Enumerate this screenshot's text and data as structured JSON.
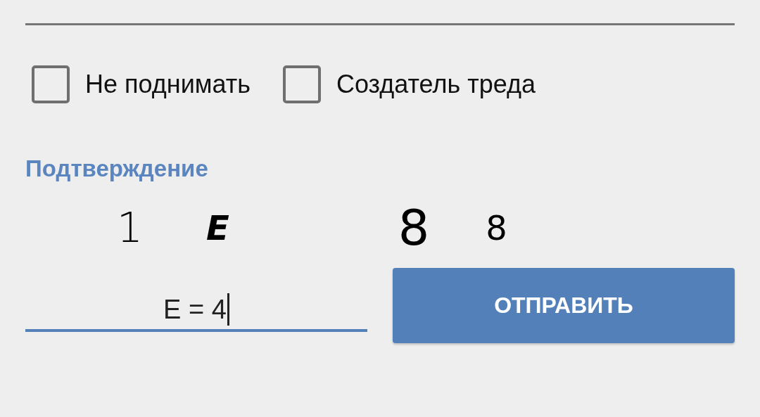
{
  "options": [
    {
      "label": "Не поднимать",
      "checked": false
    },
    {
      "label": "Создатель треда",
      "checked": false
    }
  ],
  "captcha": {
    "heading": "Подтверждение",
    "glyphs": [
      "1",
      "E",
      "8",
      "8"
    ]
  },
  "answer": {
    "value": "E = 4",
    "focused": true
  },
  "submit": {
    "label": "ОТПРАВИТЬ"
  }
}
